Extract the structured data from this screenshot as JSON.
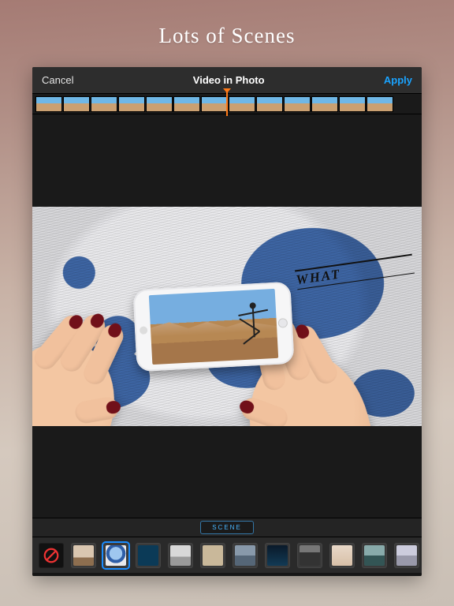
{
  "promo": {
    "headline": "Lots of Scenes"
  },
  "navbar": {
    "cancel": "Cancel",
    "title": "Video in Photo",
    "apply": "Apply"
  },
  "filmstrip": {
    "frame_count": 13
  },
  "canvas": {
    "newspaper_headline": "WHAT"
  },
  "tabbar": {
    "scene_label": "SCENE"
  },
  "scenes": {
    "selected_index": 2,
    "items": [
      {
        "name": "none"
      },
      {
        "name": "hands-phone-table"
      },
      {
        "name": "hands-phone-globe"
      },
      {
        "name": "tablet-desk"
      },
      {
        "name": "laptop-minimal"
      },
      {
        "name": "frame-wall"
      },
      {
        "name": "tv-room"
      },
      {
        "name": "devices-dark"
      },
      {
        "name": "billboard"
      },
      {
        "name": "card-hand"
      },
      {
        "name": "monitor-office"
      },
      {
        "name": "laptop-side"
      }
    ]
  },
  "colors": {
    "accent": "#1aa3ff"
  }
}
